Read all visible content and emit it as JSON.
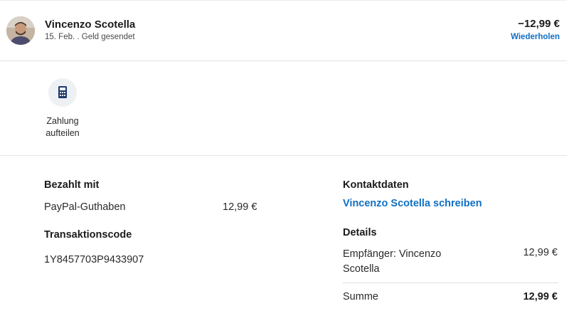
{
  "header": {
    "name": "Vincenzo Scotella",
    "subtitle": "15. Feb. . Geld gesendet",
    "amount": "−12,99 €",
    "repeat_label": "Wiederholen"
  },
  "actions": [
    {
      "label_line1": "Zahlung",
      "label_line2": "aufteilen",
      "icon": "calculator-icon"
    }
  ],
  "paid_with": {
    "heading": "Bezahlt mit",
    "method": "PayPal-Guthaben",
    "amount": "12,99 €"
  },
  "transaction": {
    "heading": "Transaktionscode",
    "code": "1Y8457703P9433907"
  },
  "contact": {
    "heading": "Kontaktdaten",
    "link": "Vincenzo Scotella schreiben"
  },
  "details": {
    "heading": "Details",
    "recipient_line1": "Empfänger: Vincenzo",
    "recipient_line2": "Scotella",
    "recipient_amount": "12,99 €",
    "sum_label": "Summe",
    "sum_amount": "12,99 €"
  },
  "colors": {
    "accent": "#1070c4",
    "icon": "#1e3a6b",
    "icon_bg": "#eef1f4"
  }
}
